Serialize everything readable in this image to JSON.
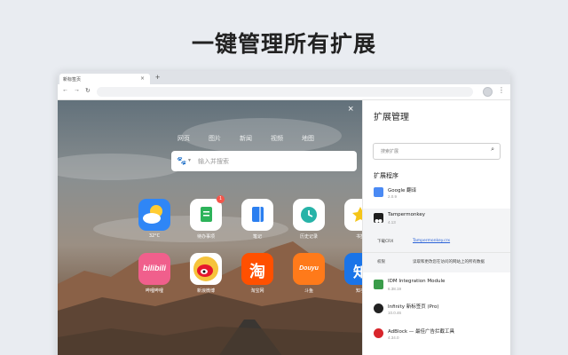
{
  "headline": "一键管理所有扩展",
  "browser": {
    "tab_title": "新标签页",
    "tab_close": "×",
    "new_tab": "+",
    "back": "←",
    "forward": "→",
    "reload": "↻",
    "menu": "⋮"
  },
  "newtab": {
    "close": "×",
    "search_tabs": [
      "网页",
      "图片",
      "新闻",
      "视频",
      "地图"
    ],
    "search_placeholder": "输入并搜索",
    "apps_row1": [
      {
        "label": "32°C",
        "icon": "weather-icon",
        "color": "#2f86f6"
      },
      {
        "label": "待办事项",
        "icon": "todo-icon",
        "color": "#ffffff",
        "badge": "1"
      },
      {
        "label": "笔记",
        "icon": "notes-icon",
        "color": "#ffffff"
      },
      {
        "label": "历史记录",
        "icon": "history-icon",
        "color": "#ffffff"
      },
      {
        "label": "书签",
        "icon": "bookmark-icon",
        "color": "#ffffff"
      }
    ],
    "apps_row2": [
      {
        "label": "哔哩哔哩",
        "icon": "bilibili-icon",
        "color": "#f05f8c",
        "glyph": "bilibili"
      },
      {
        "label": "新浪微博",
        "icon": "weibo-icon",
        "color": "#ffffff"
      },
      {
        "label": "淘宝网",
        "icon": "taobao-icon",
        "color": "#ff5000",
        "glyph": "淘"
      },
      {
        "label": "斗鱼",
        "icon": "douyu-icon",
        "color": "#ff7a1a",
        "glyph": "Douyu"
      },
      {
        "label": "知乎",
        "icon": "zhihu-icon",
        "color": "#1a74e8",
        "glyph": "知"
      }
    ]
  },
  "panel": {
    "title": "扩展管理",
    "search_placeholder": "搜索扩展",
    "section": "扩展程序",
    "extensions": [
      {
        "name": "Google 翻译",
        "version": "2.0.9",
        "icon": "google-translate-icon",
        "color": "#4a8af4"
      },
      {
        "name": "Tampermonkey",
        "version": "4.13",
        "icon": "tampermonkey-icon",
        "color": "#1e1e1e"
      },
      {
        "name": "IDM Integration Module",
        "version": "6.38.19",
        "icon": "idm-icon",
        "color": "#3a9c4a"
      },
      {
        "name": "Infinity 新标签页 (Pro)",
        "version": "10.0.46",
        "icon": "infinity-icon",
        "color": "#222222"
      },
      {
        "name": "AdBlock — 最佳广告拦截工具",
        "version": "4.34.0",
        "icon": "adblock-icon",
        "color": "#d8252b"
      }
    ],
    "detail": {
      "download_key": "下载CRX",
      "download_value": "Tampermonkey.crx",
      "permission_key": "权限",
      "permission_value": "读取和更改您在访问的网站上的所有数据"
    }
  }
}
